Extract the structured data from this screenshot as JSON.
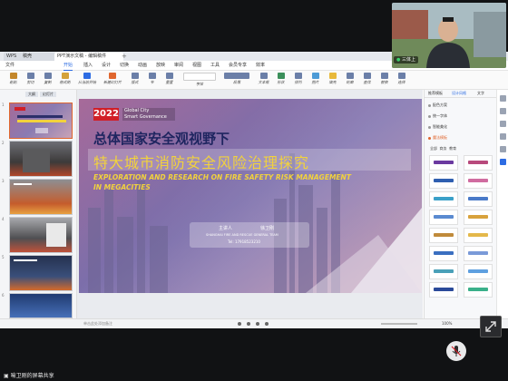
{
  "window": {
    "tabs": [
      {
        "label": "WPS"
      },
      {
        "label": "稿壳"
      },
      {
        "label": "PPT演示文稿 - 编辑稿件"
      }
    ],
    "menus": [
      "文件",
      "开始",
      "插入",
      "设计",
      "切换",
      "动画",
      "放映",
      "审阅",
      "视图",
      "工具",
      "会员专享",
      "效率"
    ],
    "active_menu": "开始",
    "ribbon_labels": [
      "粘贴",
      "剪切",
      "复制",
      "格式刷",
      "从当前开始",
      "新建幻灯片",
      "版式",
      "节",
      "重置",
      "字体",
      "段落",
      "文本框",
      "形状",
      "排列",
      "图片",
      "填充",
      "轮廓",
      "查找",
      "替换",
      "选择"
    ],
    "thumb_tabs": [
      "大纲",
      "幻灯片"
    ]
  },
  "slide": {
    "badge_year": "2022",
    "badge_line1": "Global City",
    "badge_line2": "Smart Governance",
    "title_cn_1": "总体国家安全观视野下",
    "title_cn_2": "特大城市消防安全风险治理探究",
    "title_en_1": "EXPLORATION AND RESEARCH ON FIRE SAFETY RISK MANAGEMENT",
    "title_en_2": "IN MEGACITIES",
    "speaker_label": "主讲人",
    "speaker_name": "徐卫刚",
    "affiliation": "SHANGHAI FIRE AND RESCUE GENERAL TEAM",
    "phone": "Tel: 17918523210"
  },
  "thumbnails": [
    {
      "num": "1",
      "selected": true
    },
    {
      "num": "2",
      "selected": false
    },
    {
      "num": "3",
      "selected": false
    },
    {
      "num": "4",
      "selected": false
    },
    {
      "num": "5",
      "selected": false
    },
    {
      "num": "6",
      "selected": false
    }
  ],
  "right_panel": {
    "tabs": [
      "推荐模板",
      "设计风格",
      "文字"
    ],
    "sections": [
      "配色方案",
      "统一字体",
      "智能美化",
      "魔法模板"
    ],
    "mini_tabs": [
      "全部",
      "商务",
      "教育"
    ]
  },
  "status": {
    "notes_placeholder": "单击此处添加备注",
    "zoom": "100%"
  },
  "webcam": {
    "name": "三体上"
  },
  "meeting": {
    "bottom_name": "喻卫刚的屏幕共享"
  },
  "colors": {
    "accent": "#2d6ce3",
    "badge_red": "#d11f27",
    "title_yellow": "#f2d23c",
    "selection_orange": "#e0662e"
  }
}
